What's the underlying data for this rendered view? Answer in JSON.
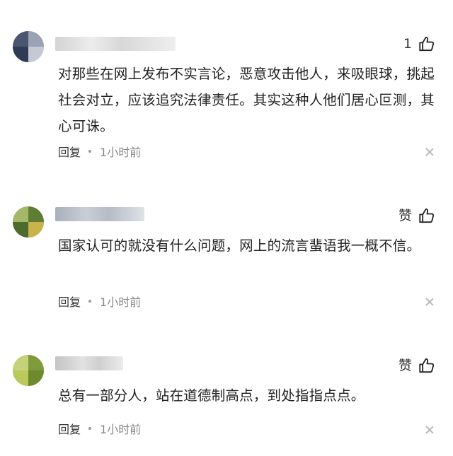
{
  "comments": [
    {
      "like_label": "1",
      "text": "对那些在网上发布不实言论，恶意攻击他人，来吸眼球，挑起社会对立，应该追究法律责任。其实这种人他们居心叵测，其心可诛。",
      "reply_label": "回复",
      "time": "1小时前"
    },
    {
      "like_label": "赞",
      "text": "国家认可的就没有什么问题，网上的流言蜚语我一概不信。",
      "reply_label": "回复",
      "time": "1小时前"
    },
    {
      "like_label": "赞",
      "text": "总有一部分人，站在道德制高点，到处指指点点。",
      "reply_label": "回复",
      "time": "1小时前"
    }
  ],
  "icons": {
    "like": "thumbs-up-icon",
    "close": "close-icon"
  },
  "colors": {
    "text": "#222222",
    "meta": "#888888",
    "close": "#b8b8b8"
  }
}
